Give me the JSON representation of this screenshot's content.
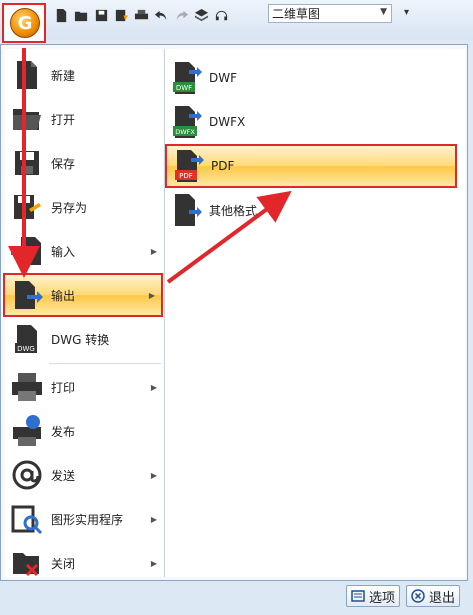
{
  "app": {
    "logo_letter": "G"
  },
  "toolbar": {
    "workspace": "二维草图",
    "icons": [
      "new-icon",
      "open-icon",
      "save-icon",
      "saveas-icon",
      "print-icon",
      "undo-icon",
      "redo-icon",
      "layers-icon",
      "headset-icon"
    ]
  },
  "menu": {
    "left_items": [
      {
        "label": "新建",
        "submenu": false
      },
      {
        "label": "打开",
        "submenu": false
      },
      {
        "label": "保存",
        "submenu": false
      },
      {
        "label": "另存为",
        "submenu": false
      },
      {
        "label": "输入",
        "submenu": true
      },
      {
        "label": "输出",
        "submenu": true
      },
      {
        "label": "DWG 转换",
        "submenu": false
      },
      {
        "label": "打印",
        "submenu": true
      },
      {
        "label": "发布",
        "submenu": false
      },
      {
        "label": "发送",
        "submenu": true
      },
      {
        "label": "图形实用程序",
        "submenu": true
      },
      {
        "label": "关闭",
        "submenu": true
      }
    ],
    "right_items": [
      {
        "label": "DWF",
        "badge": "DWF"
      },
      {
        "label": "DWFX",
        "badge": "DWFX"
      },
      {
        "label": "PDF",
        "badge": "PDF"
      },
      {
        "label": "其他格式",
        "badge": ""
      }
    ]
  },
  "footer": {
    "options_label": "选项",
    "exit_label": "退出"
  },
  "colors": {
    "highlight": "#e3262a",
    "accent": "#ffc845",
    "arrow": "#e3262a"
  }
}
